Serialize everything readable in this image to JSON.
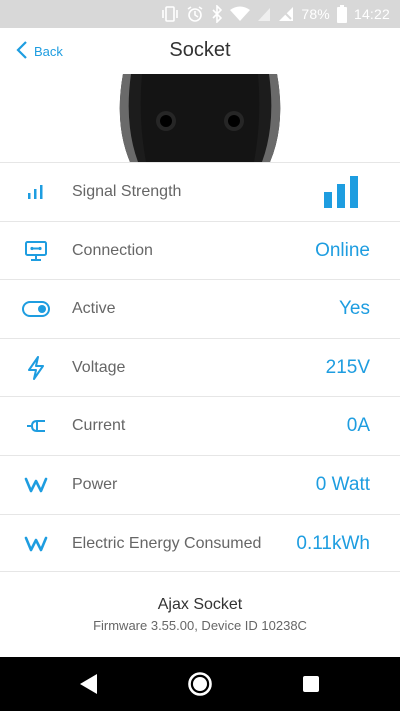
{
  "status_bar": {
    "battery_text": "78%",
    "time": "14:22",
    "icons": [
      "vibrate-icon",
      "alarm-icon",
      "bluetooth-icon",
      "wifi-icon",
      "signal-icon",
      "no-signal-icon",
      "battery-icon"
    ]
  },
  "nav": {
    "back_label": "Back",
    "title": "Socket"
  },
  "rows": [
    {
      "icon": "signal-bars-icon",
      "label": "Signal Strength",
      "value": "",
      "signal_level": 3,
      "signal_max": 3
    },
    {
      "icon": "connection-icon",
      "label": "Connection",
      "value": "Online"
    },
    {
      "icon": "toggle-icon",
      "label": "Active",
      "value": "Yes"
    },
    {
      "icon": "lightning-icon",
      "label": "Voltage",
      "value": "215V"
    },
    {
      "icon": "plug-icon",
      "label": "Current",
      "value": "0A"
    },
    {
      "icon": "watt-icon",
      "label": "Power",
      "value": "0 Watt"
    },
    {
      "icon": "watt-icon",
      "label": "Electric Energy Consumed",
      "value": "0.11kWh"
    }
  ],
  "footer": {
    "device_name": "Ajax Socket",
    "device_info": "Firmware 3.55.00, Device ID 10238C"
  },
  "colors": {
    "accent": "#1e9de0",
    "status_bar": "#d8d8d8",
    "nav_bar": "#000000"
  }
}
